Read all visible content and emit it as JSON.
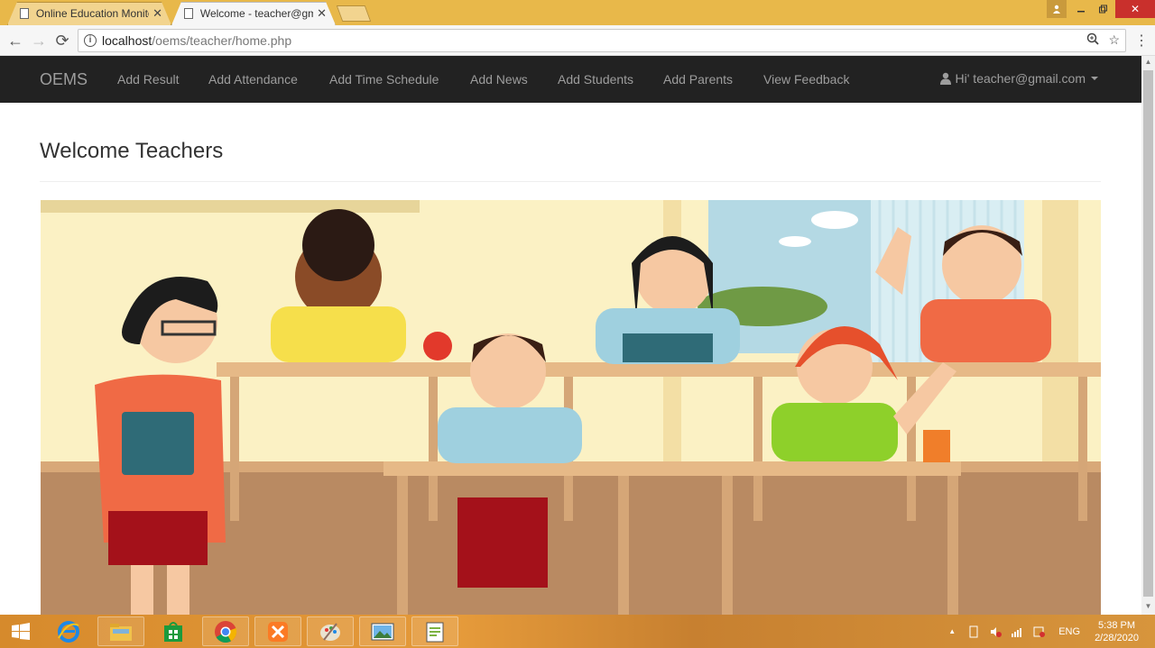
{
  "browser": {
    "tabs": [
      {
        "title": "Online Education Monitor",
        "active": false
      },
      {
        "title": "Welcome - teacher@gmail.com",
        "active": true
      }
    ],
    "url_host": "localhost",
    "url_path": "/oems/teacher/home.php"
  },
  "navbar": {
    "brand": "OEMS",
    "links": [
      "Add Result",
      "Add Attendance",
      "Add Time Schedule",
      "Add News",
      "Add Students",
      "Add Parents",
      "View Feedback"
    ],
    "user_label": "Hi' teacher@gmail.com"
  },
  "page": {
    "heading": "Welcome Teachers"
  },
  "taskbar": {
    "apps": [
      "start-icon",
      "internet-explorer-icon",
      "file-explorer-icon",
      "store-icon",
      "chrome-icon",
      "xampp-icon",
      "paint-icon",
      "photos-icon",
      "notepad-plus-icon"
    ],
    "language": "ENG",
    "time": "5:38 PM",
    "date": "2/28/2020"
  },
  "colors": {
    "navbar_bg": "#222222",
    "navbar_text": "#9d9d9d",
    "tabstrip": "#e8b84a",
    "taskbar": "#d68a2c"
  }
}
